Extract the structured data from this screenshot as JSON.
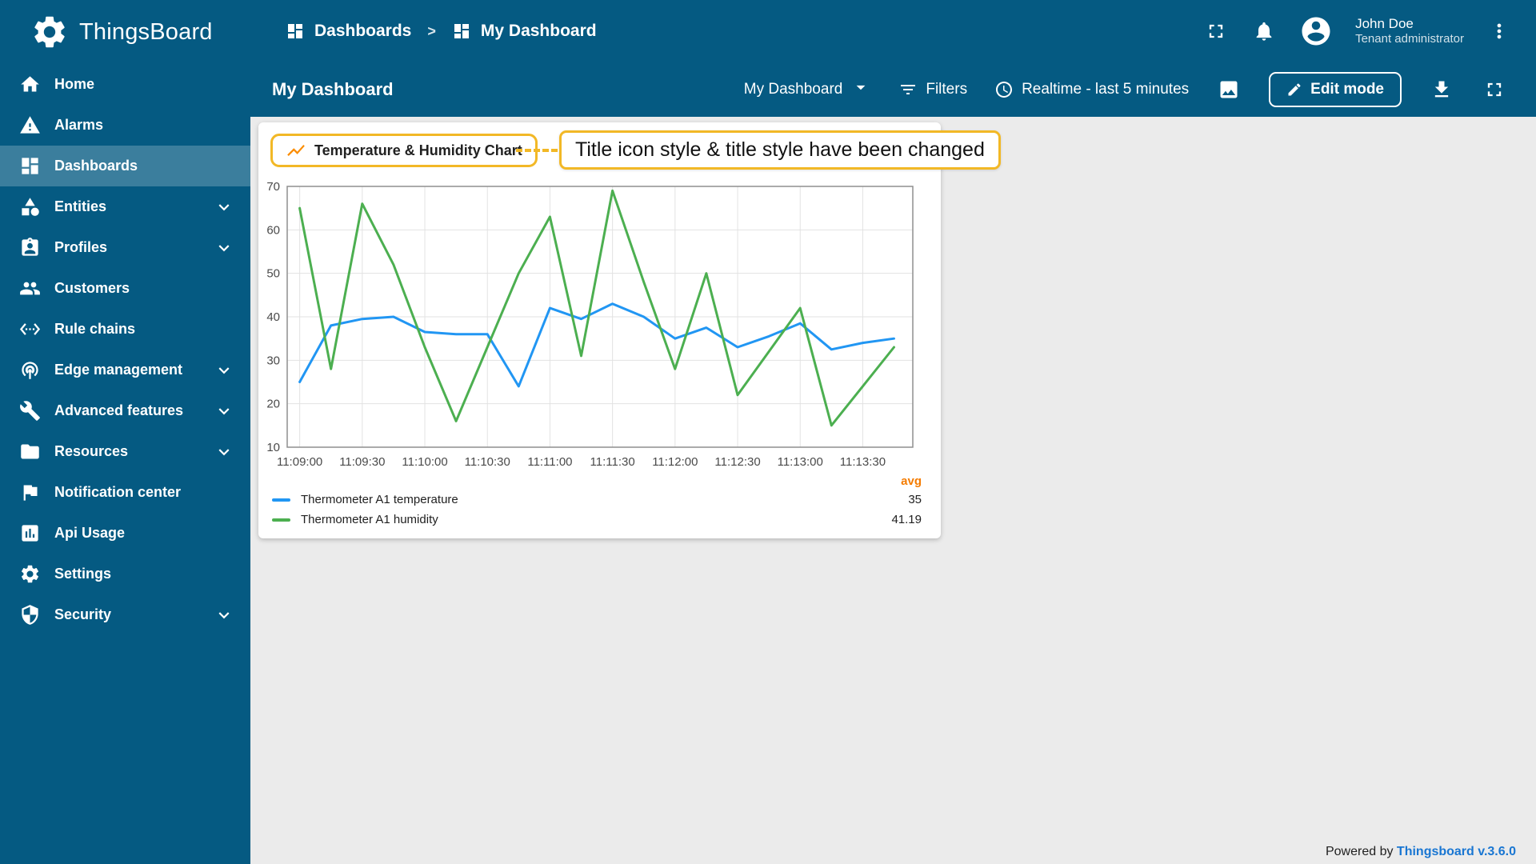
{
  "app": {
    "brand": "ThingsBoard"
  },
  "sidebar": {
    "items": [
      {
        "label": "Home",
        "icon": "home-icon",
        "expandable": false,
        "active": false
      },
      {
        "label": "Alarms",
        "icon": "alarms-icon",
        "expandable": false,
        "active": false
      },
      {
        "label": "Dashboards",
        "icon": "dashboards-icon",
        "expandable": false,
        "active": true
      },
      {
        "label": "Entities",
        "icon": "entities-icon",
        "expandable": true,
        "active": false
      },
      {
        "label": "Profiles",
        "icon": "profiles-icon",
        "expandable": true,
        "active": false
      },
      {
        "label": "Customers",
        "icon": "customers-icon",
        "expandable": false,
        "active": false
      },
      {
        "label": "Rule chains",
        "icon": "rule-chains-icon",
        "expandable": false,
        "active": false
      },
      {
        "label": "Edge management",
        "icon": "edge-management-icon",
        "expandable": true,
        "active": false
      },
      {
        "label": "Advanced features",
        "icon": "advanced-features-icon",
        "expandable": true,
        "active": false
      },
      {
        "label": "Resources",
        "icon": "resources-icon",
        "expandable": true,
        "active": false
      },
      {
        "label": "Notification center",
        "icon": "notification-center-icon",
        "expandable": false,
        "active": false
      },
      {
        "label": "Api Usage",
        "icon": "api-usage-icon",
        "expandable": false,
        "active": false
      },
      {
        "label": "Settings",
        "icon": "settings-icon",
        "expandable": false,
        "active": false
      },
      {
        "label": "Security",
        "icon": "security-icon",
        "expandable": true,
        "active": false
      }
    ]
  },
  "header": {
    "breadcrumb": [
      {
        "label": "Dashboards"
      },
      {
        "label": "My Dashboard"
      }
    ],
    "separator": ">",
    "user": {
      "name": "John Doe",
      "role": "Tenant administrator"
    }
  },
  "toolbar": {
    "title": "My Dashboard",
    "dashboard_select": "My Dashboard",
    "filters_label": "Filters",
    "timewindow_label": "Realtime - last 5 minutes",
    "edit_mode_label": "Edit mode"
  },
  "widget": {
    "title": "Temperature & Humidity Chart",
    "annotation": "Title icon style & title style have been changed"
  },
  "chart_data": {
    "type": "line",
    "title": "Temperature & Humidity Chart",
    "x_labels": [
      "11:09:00",
      "11:09:30",
      "11:10:00",
      "11:10:30",
      "11:11:00",
      "11:11:30",
      "11:12:00",
      "11:12:30",
      "11:13:00",
      "11:13:30"
    ],
    "point_interval_s": 15,
    "tick_interval_s": 30,
    "ylim": [
      10,
      70
    ],
    "y_ticks": [
      10,
      20,
      30,
      40,
      50,
      60,
      70
    ],
    "grid": true,
    "legend_position": "bottom",
    "legend_avg_header": "avg",
    "series": [
      {
        "name": "Thermometer A1 temperature",
        "color": "#2196f3",
        "avg": "35",
        "values": [
          25,
          38,
          39.5,
          40,
          36.5,
          36,
          36,
          24,
          42,
          39.5,
          43,
          40,
          35,
          37.5,
          33,
          35.5,
          38.5,
          32.5,
          34,
          35
        ]
      },
      {
        "name": "Thermometer A1 humidity",
        "color": "#4caf50",
        "avg": "41.19",
        "values": [
          65,
          28,
          66,
          52,
          33,
          16,
          33,
          50,
          63,
          31,
          69,
          48,
          28,
          50,
          22,
          32,
          42,
          15,
          24,
          33
        ]
      }
    ]
  },
  "footer": {
    "powered_by": "Powered by",
    "link_label": "Thingsboard v.3.6.0"
  },
  "colors": {
    "sidebar_bg": "#055a82",
    "active_item_overlay": "rgba(255,255,255,0.22)",
    "highlight_yellow": "#f2b826",
    "title_icon_orange": "#fb8c00",
    "avg_orange": "#f57c00",
    "link_blue": "#1976d2",
    "content_bg": "#ebebeb"
  }
}
